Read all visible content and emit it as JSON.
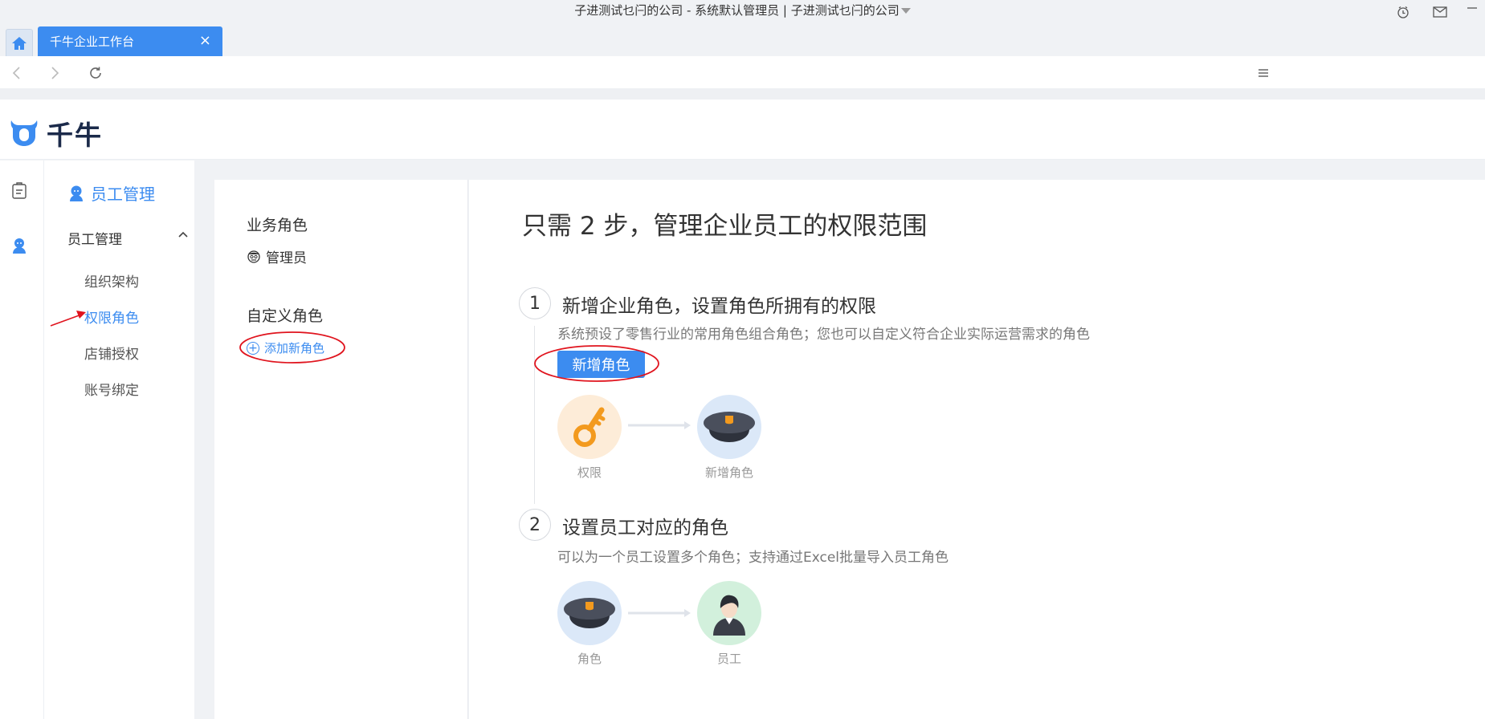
{
  "window": {
    "title": "子进测试乜闩的公司 - 系统默认管理员 | 子进测试乜闩的公司"
  },
  "tabs": [
    {
      "label": "千牛企业工作台",
      "close": "×"
    }
  ],
  "app": {
    "logo_text": "千牛"
  },
  "rail": {
    "icons": [
      "clipboard-icon",
      "user-icon"
    ]
  },
  "sidemenu": {
    "header": "员工管理",
    "group": "员工管理",
    "items": [
      {
        "label": "组织架构"
      },
      {
        "label": "权限角色",
        "active": true
      },
      {
        "label": "店铺授权"
      },
      {
        "label": "账号绑定"
      }
    ]
  },
  "roles": {
    "business_title": "业务角色",
    "admin": "管理员",
    "custom_title": "自定义角色",
    "add_new": "添加新角色"
  },
  "guide": {
    "title": "只需 2 步，管理企业员工的权限范围",
    "steps": [
      {
        "num": "1",
        "title": "新增企业角色，设置角色所拥有的权限",
        "desc": "系统预设了零售行业的常用角色组合角色；您也可以自定义符合企业实际运营需求的角色",
        "button": "新增角色",
        "from_label": "权限",
        "to_label": "新增角色"
      },
      {
        "num": "2",
        "title": "设置员工对应的角色",
        "desc": "可以为一个员工设置多个角色；支持通过Excel批量导入员工角色",
        "from_label": "角色",
        "to_label": "员工"
      }
    ]
  },
  "colors": {
    "accent": "#3c8cf0",
    "annotation": "#e0141e"
  }
}
